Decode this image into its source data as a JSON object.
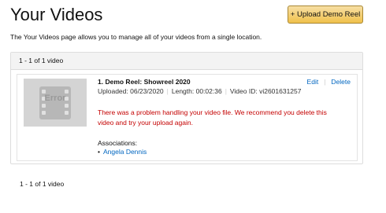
{
  "header": {
    "title": "Your Videos",
    "upload_button": "+ Upload Demo Reel"
  },
  "description": "The Your Videos page allows you to manage all of your videos from a single location.",
  "list": {
    "count_label": "1 - 1 of 1 video",
    "videos": [
      {
        "thumbnail_label": "Error",
        "title": "1. Demo Reel: Showreel 2020",
        "uploaded": "Uploaded: 06/23/2020",
        "length": "Length: 00:02:36",
        "video_id": "Video ID: vi2601631257",
        "edit_label": "Edit",
        "delete_label": "Delete",
        "error_message": "There was a problem handling your video file. We recommend you delete this video and try your upload again.",
        "associations_label": "Associations:",
        "associations": [
          "Angela Dennis"
        ]
      }
    ]
  },
  "footer": {
    "count_label": "1 - 1 of 1 video"
  },
  "colors": {
    "link": "#0066c0",
    "error": "#c40000",
    "button": "#f0c14b"
  }
}
